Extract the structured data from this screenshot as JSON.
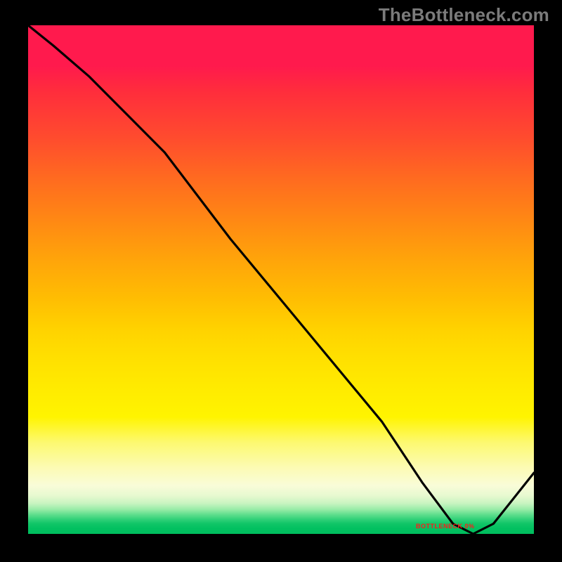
{
  "watermark": "TheBottleneck.com",
  "bottom_label": "BOTTLENECK 0%",
  "colors": {
    "curve": "#000000",
    "watermark": "#7b7b7b",
    "bottom_label": "#ff1a1a",
    "gradient_top": "#ff1a4d",
    "gradient_bottom": "#00bd5d"
  },
  "chart_data": {
    "type": "line",
    "title": "",
    "xlabel": "",
    "ylabel": "",
    "xlim": [
      0,
      100
    ],
    "ylim": [
      0,
      100
    ],
    "series": [
      {
        "name": "bottleneck-curve",
        "x": [
          0,
          5,
          12,
          20,
          27,
          40,
          55,
          70,
          78,
          84,
          88,
          92,
          100
        ],
        "y": [
          100,
          96,
          90,
          82,
          75,
          58,
          40,
          22,
          10,
          2,
          0,
          2,
          12
        ]
      }
    ],
    "annotations": [
      {
        "text": "BOTTLENECK 0%",
        "x": 85,
        "y": 0
      }
    ],
    "background_gradient": {
      "direction": "vertical",
      "stops": [
        {
          "pos": 0.0,
          "color": "#ff1a4d"
        },
        {
          "pos": 0.5,
          "color": "#ffbe02"
        },
        {
          "pos": 0.8,
          "color": "#fff400"
        },
        {
          "pos": 0.92,
          "color": "#e7f9d0"
        },
        {
          "pos": 1.0,
          "color": "#00bd5d"
        }
      ]
    }
  }
}
